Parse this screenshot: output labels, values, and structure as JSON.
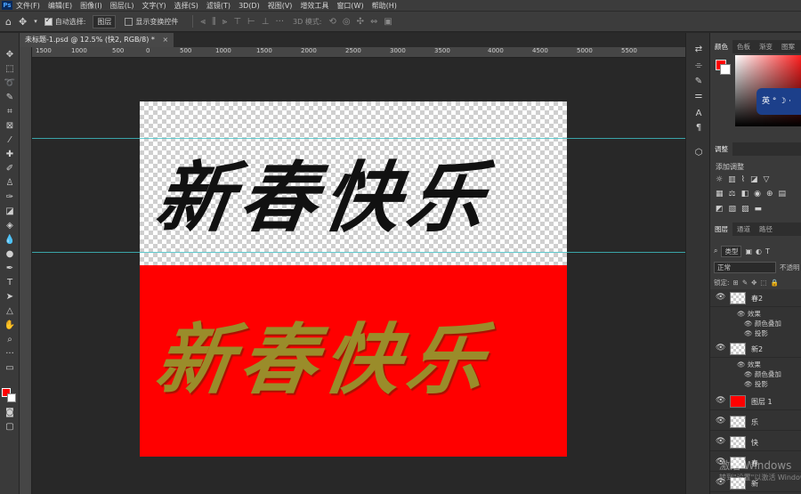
{
  "menubar": {
    "logo": "Ps",
    "items": [
      "文件(F)",
      "编辑(E)",
      "图像(I)",
      "图层(L)",
      "文字(Y)",
      "选择(S)",
      "滤镜(T)",
      "3D(D)",
      "视图(V)",
      "增效工具",
      "窗口(W)",
      "帮助(H)"
    ]
  },
  "options": {
    "auto_select_label": "自动选择:",
    "auto_select_value": "图层",
    "show_transform_label": "显示变换控件",
    "mode_3d_label": "3D 模式:"
  },
  "document_tab": {
    "title": "未标题-1.psd @ 12.5% (快2, RGB/8) *",
    "close": "×"
  },
  "ruler": {
    "ticks": [
      "1500",
      "1000",
      "500",
      "0",
      "500",
      "1000",
      "1500",
      "2000",
      "2500",
      "3000",
      "3500",
      "4000",
      "4500",
      "5000",
      "5500"
    ]
  },
  "canvas": {
    "text_top": "新春快乐",
    "text_bottom": "新春快乐",
    "transparent_color": "checker",
    "red_color": "#ff0000",
    "gold_color": "#9a8c2a"
  },
  "color_panel": {
    "tabs": [
      "颜色",
      "色板",
      "渐变",
      "图案"
    ],
    "ime": "英 ° ☽ ·"
  },
  "adjust_panel": {
    "tabs": [
      "调整"
    ],
    "title": "添加调整"
  },
  "layers_panel": {
    "tabs": [
      "图层",
      "通道",
      "路径"
    ],
    "filter_kind": "类型",
    "blend_mode": "正常",
    "opacity_label": "不透明",
    "lock_label": "锁定:",
    "layers": [
      {
        "name": "春2",
        "thumb": "checker",
        "visible": true
      },
      {
        "name": "新2",
        "thumb": "checker",
        "visible": true
      },
      {
        "name": "图层 1",
        "thumb": "red",
        "visible": true
      },
      {
        "name": "乐",
        "thumb": "checker",
        "visible": true
      },
      {
        "name": "快",
        "thumb": "checker",
        "visible": true
      },
      {
        "name": "春",
        "thumb": "checker",
        "visible": true
      },
      {
        "name": "新",
        "thumb": "checker",
        "visible": true
      }
    ],
    "effects_label": "效果",
    "effect_overlay": "颜色叠加",
    "effect_shadow": "投影"
  },
  "watermark": {
    "line1": "激活 Windows",
    "line2": "转到\"设置\"以激活 Windows。"
  }
}
